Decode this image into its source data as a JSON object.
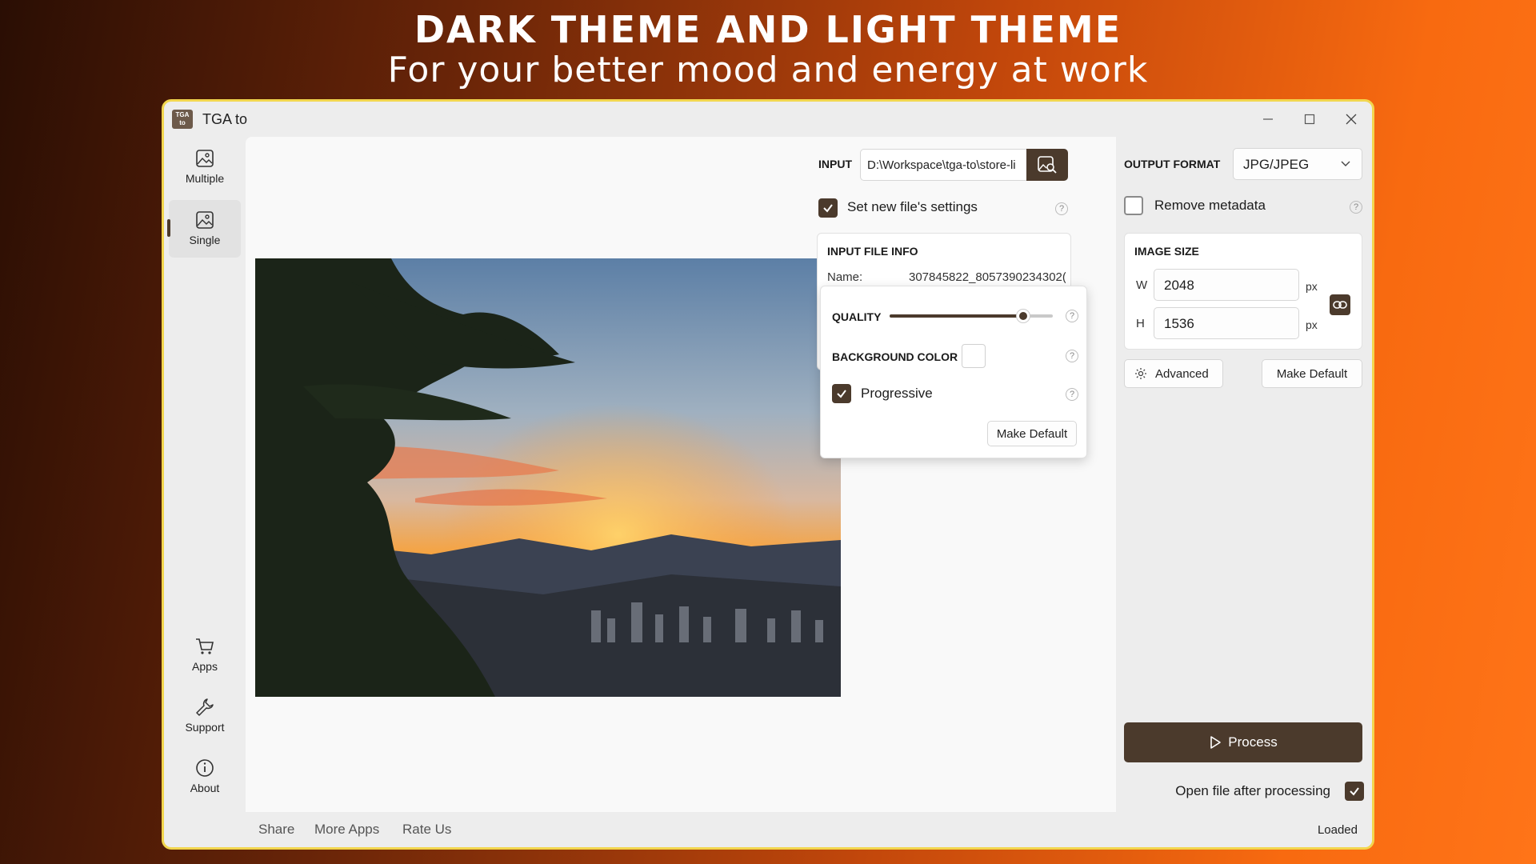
{
  "headline": {
    "title": "DARK THEME AND LIGHT THEME",
    "subtitle": "For your better mood and energy at work"
  },
  "window": {
    "logo_text": "TGA to",
    "title": "TGA to",
    "controls": {
      "minimize": "—",
      "maximize": "☐",
      "close": "✕"
    }
  },
  "nav": {
    "items": [
      {
        "label": "Multiple",
        "icon": "image-icon"
      },
      {
        "label": "Single",
        "icon": "image-icon",
        "active": true
      }
    ],
    "bottom": [
      {
        "label": "Apps",
        "icon": "cart-icon"
      },
      {
        "label": "Support",
        "icon": "wrench-icon"
      },
      {
        "label": "About",
        "icon": "info-icon"
      }
    ]
  },
  "input": {
    "label": "INPUT",
    "path": "D:\\Workspace\\tga-to\\store-li",
    "browse_icon": "browse-image-icon"
  },
  "settings": {
    "set_new_label": "Set new file's settings",
    "set_new_checked": true,
    "help": "?"
  },
  "file_info": {
    "title": "INPUT FILE INFO",
    "name_label": "Name:",
    "name_value": "307845822_8057390234302("
  },
  "jpg_options": {
    "quality_label": "QUALITY",
    "quality_value": 0.82,
    "bg_label": "BACKGROUND COLOR",
    "bg_color": "#ffffff",
    "progressive_label": "Progressive",
    "progressive_checked": true,
    "make_default": "Make Default"
  },
  "output": {
    "label": "OUTPUT FORMAT",
    "format": "JPG/JPEG",
    "remove_meta_label": "Remove metadata",
    "remove_meta_checked": false,
    "size_title": "IMAGE SIZE",
    "w_label": "W",
    "w_value": "2048",
    "h_label": "H",
    "h_value": "1536",
    "unit": "px",
    "advanced": "Advanced",
    "make_default": "Make Default",
    "process": "Process",
    "open_after_label": "Open file after processing",
    "open_after_checked": true
  },
  "footer": {
    "links": [
      "Share",
      "More Apps",
      "Rate Us"
    ],
    "status": "Loaded"
  },
  "colors": {
    "accent": "#4b3a2c",
    "window_border": "#f2d64e"
  }
}
